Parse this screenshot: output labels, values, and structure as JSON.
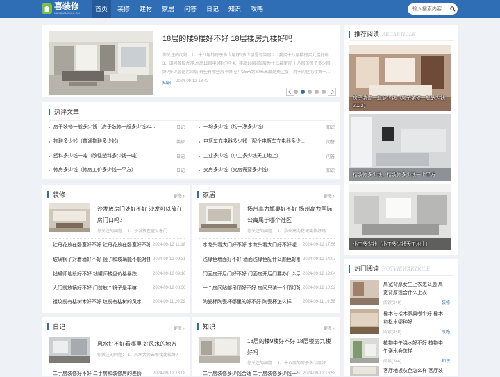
{
  "brand": {
    "name": "喜装修",
    "sub": "XIZHUANGXIU.CN"
  },
  "nav": [
    {
      "label": "首页",
      "active": true
    },
    {
      "label": "装修"
    },
    {
      "label": "建材"
    },
    {
      "label": "家居"
    },
    {
      "label": "问答"
    },
    {
      "label": "日记"
    },
    {
      "label": "知识"
    },
    {
      "label": "攻略"
    }
  ],
  "search": {
    "placeholder": "输入搜索内容..."
  },
  "featured": {
    "title": "18层的楼9楼好不好 18层楼房九楼好吗",
    "excerpt_1": "你关注的问题：1、十八层的房子多少层好?多少层是污染层 2、我买十八层楼房买九楼好吗",
    "excerpt_2": "3、请问各位大神,总高18层中9楼好吗 4、楼高18层买9层为什么最便宜 十八层的房子多少层",
    "excerpt_3": "好?多少层是污染层 有些有哪些层不好 空中25米到30米高度是扬尘层，对于的住宅楼第一...",
    "category": "知识",
    "date": "2024-09-12 18:42"
  },
  "hot_comments": {
    "title": "热评文章",
    "left": [
      {
        "text": "房子装修一般多少钱（房子装修一般多少钱20...",
        "tag": "日记"
      },
      {
        "text": "拖鞋多少钱（普通拖鞋多少钱）",
        "tag": "装修"
      },
      {
        "text": "塑料多少钱一吨（改性塑料多少钱一吨）",
        "tag": "日记"
      },
      {
        "text": "修房多少钱（修房工价多少钱一平方）",
        "tag": "日记"
      }
    ],
    "right": [
      {
        "text": "一均多少钱（均一净多少钱）",
        "tag": "知识"
      },
      {
        "text": "电瓶车充电器多少钱（配个电瓶车充电器多少...",
        "tag": "问答"
      },
      {
        "text": "工业多少钱（小工多少钱天工地上）",
        "tag": "问答"
      },
      {
        "text": "交房多少钱（交房需要多少钱）",
        "tag": "知识"
      }
    ]
  },
  "zhuangxiu": {
    "title": "装修",
    "more": "更多",
    "feature_title_1": "沙发放房门处好不好 沙发可以放在",
    "feature_title_2": "房门口吗？",
    "feature_meta": "你关注的问题：  1、沙发放在室对着门",
    "items": [
      {
        "text": "牡丹花放在卧室好不好 牡丹花放在卧室好不好",
        "date": "2024-09-12 11:18"
      },
      {
        "text": "玻璃锅子对着墙好不好 镜子和玻璃能不能对挂",
        "date": "2024-09-12 09:31"
      },
      {
        "text": "钱罐师地段好不好 钱罐师楼盘价格暴跌",
        "date": "2024-09-12 09:16"
      },
      {
        "text": "大门前放镜好不好 门前放个镜子是平嘛",
        "date": "2024-09-12 08:30"
      },
      {
        "text": "祖坟前有枯树木好不好 坟前有枯树的风水",
        "date": "2024-09-11 20:29"
      }
    ]
  },
  "jiaju": {
    "title": "家居",
    "more": "更多",
    "feature_title_1": "扬州高力瓶巢好不好 扬州高力国际",
    "feature_title_2": "公寓属于哪个社区",
    "feature_meta": "你关注的问题：  1、扬州高力花城装修好吗",
    "items": [
      {
        "text": "水龙头看大门好不好 水龙头看大门好不好呢",
        "date": "2024-09-12 17:56"
      },
      {
        "text": "浅绿色墙面好不好 墙面浅绿色配什么颜色好看",
        "date": "2024-09-12 14:07"
      },
      {
        "text": "门面房开后门好不好 门面房开后门要办什么手续",
        "date": "2024-09-12 12:04"
      },
      {
        "text": "一个房间贴部吊顶好不好 房间只装一个顶灯好",
        "date": "2024-09-12 10:32"
      },
      {
        "text": "陶瓷杯陶瓷杯哪里的好不好 陶瓷杯怎么样",
        "date": "2024-09-11 19:58"
      }
    ]
  },
  "riji": {
    "title": "日记",
    "more": "更多",
    "feature_title_1": "风水好不好看哪里 好风水的地方",
    "feature_meta": "你关注的问题：  1、风水大师去哪找比较好?",
    "item_partial": "二手房装修好不好 二手房和装修房的差价",
    "item_date": "2024-09-12 16:08"
  },
  "zhishi": {
    "title": "知识",
    "more": "更多",
    "feature_title_1": "18层的楼9楼好不好 18层楼房九楼",
    "feature_title_2": "好吗",
    "feature_meta": "你关注的问题：  1、十八层的房子多少层好",
    "item_partial": "二手房装修多少钱合适 二手房装修多少钱一平",
    "item_date": "2024-09-12 16:58"
  },
  "recommend": {
    "title": "推荐阅读",
    "sub": "RECARTICLE",
    "items": [
      {
        "caption_1": "房子装修一般多少钱（房子装修一般多少钱",
        "caption_2": "2022）"
      },
      {
        "caption_1": "精装修多少钱，精装修多少钱一个平方",
        "caption_2": ""
      },
      {
        "caption_1": "小工多少钱（小工多少钱天工地上）",
        "caption_2": ""
      }
    ]
  },
  "hot": {
    "title": "热门阅读",
    "sub": "HOTVIEWARTICLE",
    "items": [
      {
        "t1": "肩宽背厚女生上衣怎么选 肩",
        "t2": "宽背厚适合什么上衣",
        "reads": "阅读(249)",
        "tag": "装修"
      },
      {
        "t1": "橡木与松木家具哪个好 橡木",
        "t2": "和松木哪种好",
        "reads": "阅读(248)",
        "tag": "攻略"
      },
      {
        "t1": "植物中午浇水好不好 植物中",
        "t2": "午浇水会怎样",
        "reads": "阅读(244)",
        "tag": "知识"
      },
      {
        "t1": "客厅地板灰色怎么样 客厅装",
        "t2": "",
        "reads": "",
        "tag": ""
      }
    ]
  },
  "colors": {
    "primary": "#2f6db5",
    "nav_active": "#245a98",
    "logo_green": "#78c04b"
  },
  "icons": [
    "search-icon",
    "arrow-left-icon",
    "arrow-right-icon",
    "home-icon"
  ]
}
